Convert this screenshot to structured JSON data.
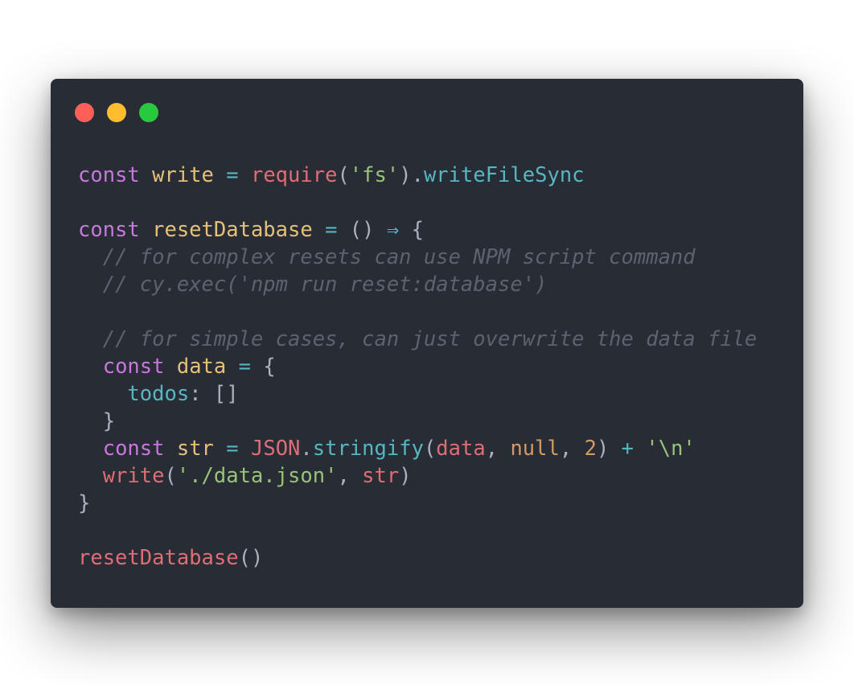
{
  "window": {
    "controls": {
      "close_color": "#ff5f56",
      "minimize_color": "#ffbd2e",
      "maximize_color": "#27c93f"
    }
  },
  "code": {
    "lines": [
      [
        {
          "t": "const",
          "c": "kw"
        },
        {
          "t": " ",
          "c": "punc"
        },
        {
          "t": "write",
          "c": "var"
        },
        {
          "t": " ",
          "c": "punc"
        },
        {
          "t": "=",
          "c": "op"
        },
        {
          "t": " ",
          "c": "punc"
        },
        {
          "t": "require",
          "c": "fn"
        },
        {
          "t": "(",
          "c": "punc"
        },
        {
          "t": "'fs'",
          "c": "str"
        },
        {
          "t": ").",
          "c": "punc"
        },
        {
          "t": "writeFileSync",
          "c": "prop"
        }
      ],
      [],
      [
        {
          "t": "const",
          "c": "kw"
        },
        {
          "t": " ",
          "c": "punc"
        },
        {
          "t": "resetDatabase",
          "c": "var"
        },
        {
          "t": " ",
          "c": "punc"
        },
        {
          "t": "=",
          "c": "op"
        },
        {
          "t": " () ",
          "c": "punc"
        },
        {
          "t": "⇒",
          "c": "op"
        },
        {
          "t": " {",
          "c": "punc"
        }
      ],
      [
        {
          "t": "  ",
          "c": "punc"
        },
        {
          "t": "// for complex resets can use NPM script command",
          "c": "cmt"
        }
      ],
      [
        {
          "t": "  ",
          "c": "punc"
        },
        {
          "t": "// cy.exec('npm run reset:database')",
          "c": "cmt"
        }
      ],
      [],
      [
        {
          "t": "  ",
          "c": "punc"
        },
        {
          "t": "// for simple cases, can just overwrite the data file",
          "c": "cmt"
        }
      ],
      [
        {
          "t": "  ",
          "c": "punc"
        },
        {
          "t": "const",
          "c": "kw"
        },
        {
          "t": " ",
          "c": "punc"
        },
        {
          "t": "data",
          "c": "var"
        },
        {
          "t": " ",
          "c": "punc"
        },
        {
          "t": "=",
          "c": "op"
        },
        {
          "t": " {",
          "c": "punc"
        }
      ],
      [
        {
          "t": "    ",
          "c": "punc"
        },
        {
          "t": "todos",
          "c": "prop"
        },
        {
          "t": ": []",
          "c": "punc"
        }
      ],
      [
        {
          "t": "  }",
          "c": "punc"
        }
      ],
      [
        {
          "t": "  ",
          "c": "punc"
        },
        {
          "t": "const",
          "c": "kw"
        },
        {
          "t": " ",
          "c": "punc"
        },
        {
          "t": "str",
          "c": "var"
        },
        {
          "t": " ",
          "c": "punc"
        },
        {
          "t": "=",
          "c": "op"
        },
        {
          "t": " ",
          "c": "punc"
        },
        {
          "t": "JSON",
          "c": "fn"
        },
        {
          "t": ".",
          "c": "punc"
        },
        {
          "t": "stringify",
          "c": "prop"
        },
        {
          "t": "(",
          "c": "punc"
        },
        {
          "t": "data",
          "c": "fn"
        },
        {
          "t": ", ",
          "c": "punc"
        },
        {
          "t": "null",
          "c": "num"
        },
        {
          "t": ", ",
          "c": "punc"
        },
        {
          "t": "2",
          "c": "num"
        },
        {
          "t": ") ",
          "c": "punc"
        },
        {
          "t": "+",
          "c": "op"
        },
        {
          "t": " ",
          "c": "punc"
        },
        {
          "t": "'\\n'",
          "c": "str"
        }
      ],
      [
        {
          "t": "  ",
          "c": "punc"
        },
        {
          "t": "write",
          "c": "fn"
        },
        {
          "t": "(",
          "c": "punc"
        },
        {
          "t": "'./data.json'",
          "c": "str"
        },
        {
          "t": ", ",
          "c": "punc"
        },
        {
          "t": "str",
          "c": "fn"
        },
        {
          "t": ")",
          "c": "punc"
        }
      ],
      [
        {
          "t": "}",
          "c": "punc"
        }
      ],
      [],
      [
        {
          "t": "resetDatabase",
          "c": "fn"
        },
        {
          "t": "()",
          "c": "punc"
        }
      ]
    ]
  }
}
